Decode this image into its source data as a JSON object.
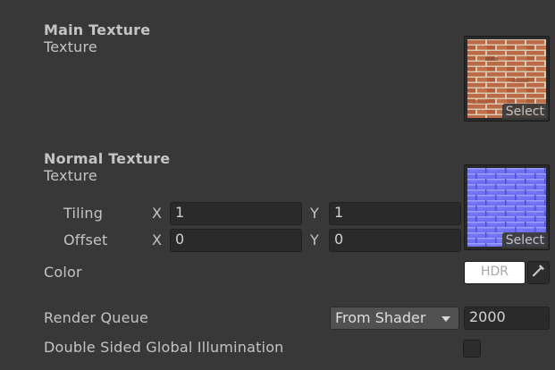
{
  "main_texture": {
    "title": "Main Texture",
    "subtitle": "Texture",
    "select_label": "Select"
  },
  "normal_texture": {
    "title": "Normal Texture",
    "subtitle": "Texture",
    "select_label": "Select",
    "tiling": {
      "label": "Tiling",
      "x_label": "X",
      "x_value": "1",
      "y_label": "Y",
      "y_value": "1"
    },
    "offset": {
      "label": "Offset",
      "x_label": "X",
      "x_value": "0",
      "y_label": "Y",
      "y_value": "0"
    }
  },
  "color": {
    "label": "Color",
    "hdr_label": "HDR",
    "swatch": "#ffffff",
    "picker_icon": "eyedropper-icon"
  },
  "render_queue": {
    "label": "Render Queue",
    "dropdown_value": "From Shader",
    "dropdown_icon": "triangle-down-icon",
    "value": "2000"
  },
  "double_sided_gi": {
    "label": "Double Sided Global Illumination",
    "checked": false
  },
  "colors": {
    "background": "#383838",
    "text": "#c4c4c4",
    "field": "#2a2a2a",
    "brick": "#b8623e",
    "normal_map": "#6c6ef0"
  }
}
